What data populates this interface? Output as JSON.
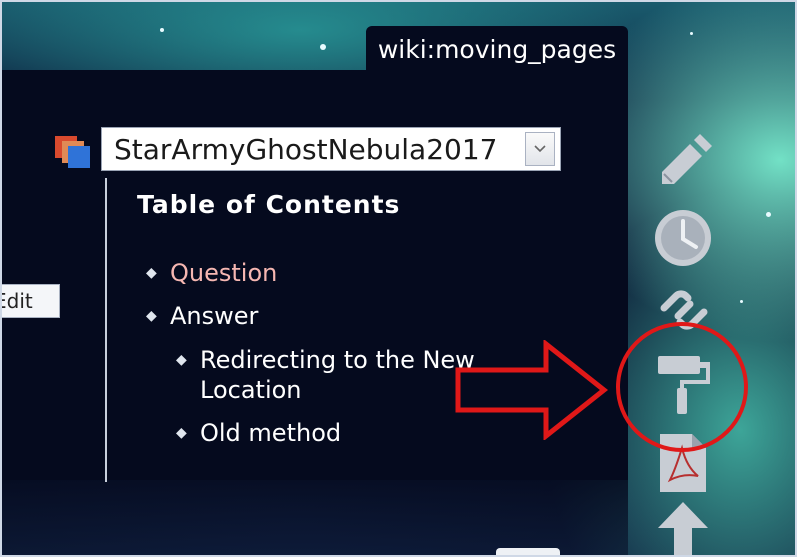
{
  "page": {
    "tab_label": "wiki:moving_pages",
    "edit_button_label": "Edit"
  },
  "namespace_select": {
    "selected_value": "StarArmyGhostNebula2017"
  },
  "toc": {
    "title": "Table of Contents",
    "items": [
      {
        "label": "Question",
        "level": 1
      },
      {
        "label": "Answer",
        "level": 1
      },
      {
        "label": "Redirecting to the New",
        "level": 2
      },
      {
        "label": "Location",
        "level": 2
      },
      {
        "label": "Old method",
        "level": 2
      }
    ]
  },
  "toolbar": {
    "icons": [
      "pencil-icon",
      "clock-icon",
      "link-icon",
      "paint-roller-icon",
      "pdf-icon",
      "arrow-up-icon"
    ]
  },
  "annotation": {
    "arrow_color": "#e01818",
    "circle_color": "#e01818"
  },
  "colors": {
    "panel_bg": "#050a1e",
    "link_text": "#f6b7b2",
    "icon_gray": "#c8cdd4"
  }
}
